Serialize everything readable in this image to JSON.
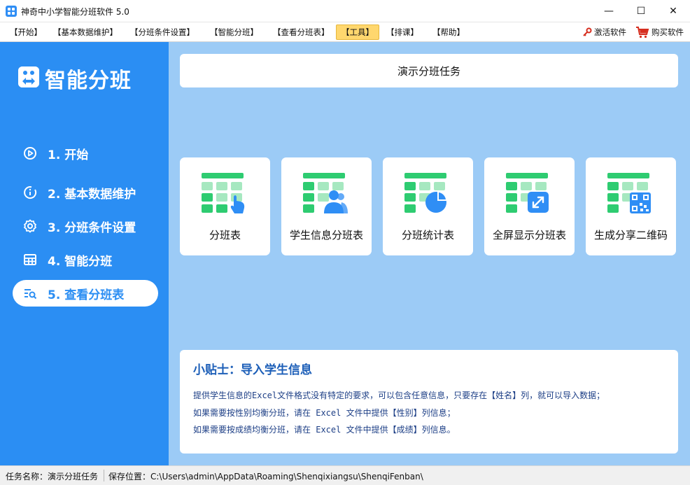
{
  "window": {
    "title": "神奇中小学智能分班软件 5.0",
    "minimize_glyph": "—",
    "maximize_glyph": "☐",
    "close_glyph": "✕"
  },
  "menu": {
    "items": [
      "【开始】",
      "【基本数据维护】",
      "【分班条件设置】",
      "【智能分班】",
      "【查看分班表】",
      "【工具】",
      "【排课】",
      "【帮助】"
    ],
    "active": "【工具】",
    "activate_label": "激活软件",
    "buy_label": "购买软件"
  },
  "sidebar": {
    "brand": "智能分班",
    "items": [
      {
        "label": "1. 开始",
        "icon": "play-circle-icon"
      },
      {
        "label": "2. 基本数据维护",
        "icon": "info-circle-icon"
      },
      {
        "label": "3. 分班条件设置",
        "icon": "gear-icon"
      },
      {
        "label": "4. 智能分班",
        "icon": "grid-table-icon"
      },
      {
        "label": "5. 查看分班表",
        "icon": "search-list-icon"
      }
    ],
    "selected": "5. 查看分班表"
  },
  "main": {
    "task_title": "演示分班任务",
    "cards": [
      {
        "label": "分班表",
        "icon": "table-hand-icon"
      },
      {
        "label": "学生信息分班表",
        "icon": "table-users-icon"
      },
      {
        "label": "分班统计表",
        "icon": "table-pie-icon"
      },
      {
        "label": "全屏显示分班表",
        "icon": "table-fullscreen-icon"
      },
      {
        "label": "生成分享二维码",
        "icon": "table-qrcode-icon"
      }
    ],
    "tip": {
      "title": "小贴士：导入学生信息",
      "lines": [
        "提供学生信息的Excel文件格式没有特定的要求，可以包含任意信息，只要存在【姓名】列，就可以导入数据；",
        "如果需要按性别均衡分班，请在 Excel 文件中提供【性别】列信息；",
        "如果需要按成绩均衡分班，请在 Excel 文件中提供【成绩】列信息。"
      ]
    }
  },
  "status": {
    "task_name": "任务名称：演示分班任务",
    "save_path": "保存位置：C:\\Users\\admin\\AppData\\Roaming\\Shenqixiangsu\\ShenqiFenban\\"
  },
  "colors": {
    "sidebar_bg": "#2b8ef3",
    "main_bg": "#9ccbf6",
    "icon_green": "#2ecc71",
    "icon_blue": "#2f8ef5",
    "tip_title": "#1d5fb8",
    "menu_active": "#ffd76e"
  }
}
